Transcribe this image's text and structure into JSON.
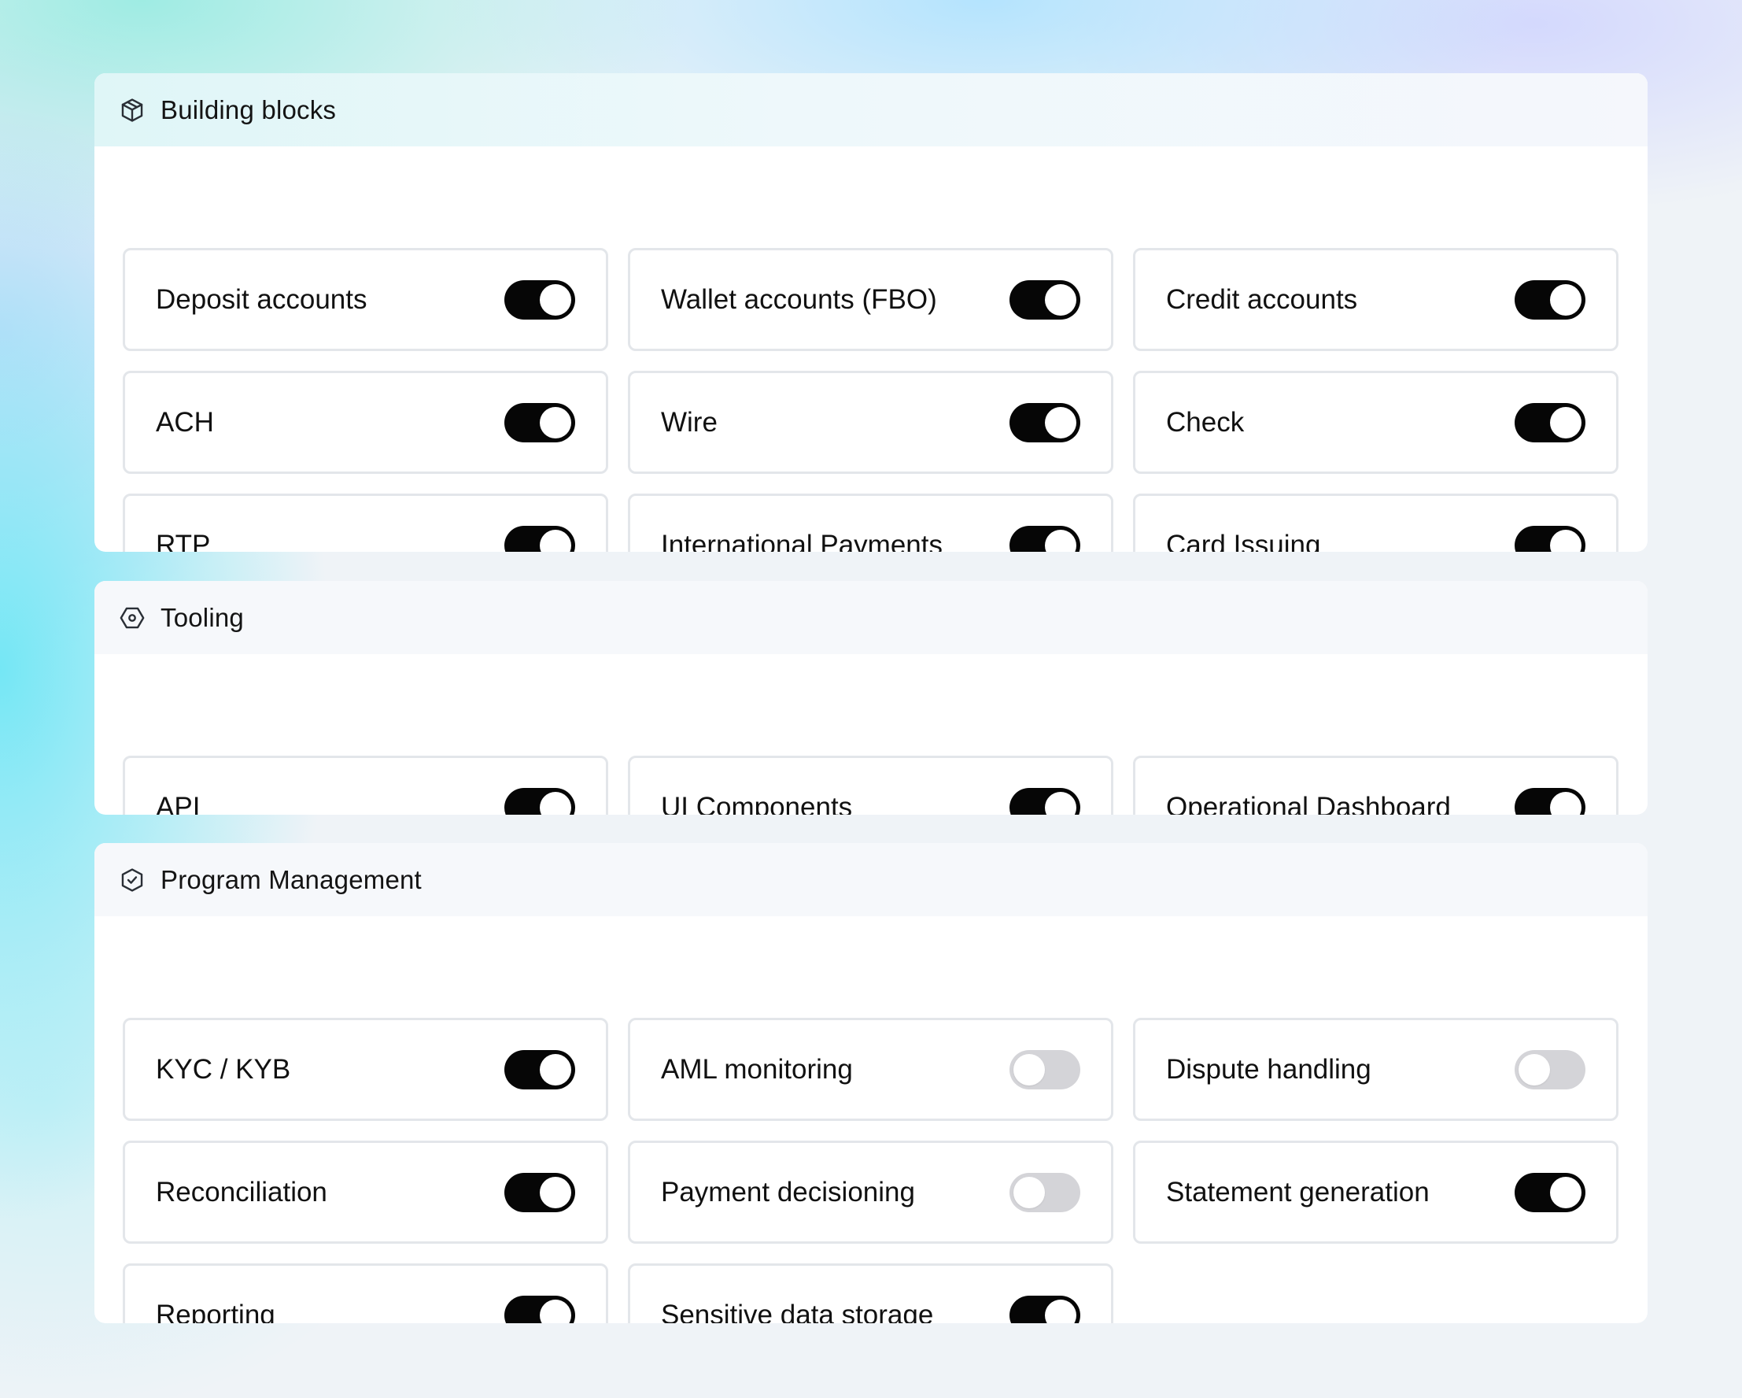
{
  "sections": [
    {
      "title": "Building blocks",
      "icon": "cube-icon",
      "items": [
        {
          "label": "Deposit accounts",
          "enabled": true
        },
        {
          "label": "Wallet accounts (FBO)",
          "enabled": true
        },
        {
          "label": "Credit accounts",
          "enabled": true
        },
        {
          "label": "ACH",
          "enabled": true
        },
        {
          "label": "Wire",
          "enabled": true
        },
        {
          "label": "Check",
          "enabled": true
        },
        {
          "label": "RTP",
          "enabled": true
        },
        {
          "label": "International Payments",
          "enabled": true
        },
        {
          "label": "Card Issuing",
          "enabled": true
        }
      ]
    },
    {
      "title": "Tooling",
      "icon": "hexagon-nut-icon",
      "items": [
        {
          "label": "API",
          "enabled": true
        },
        {
          "label": "UI Components",
          "enabled": true
        },
        {
          "label": "Operational Dashboard",
          "enabled": true
        }
      ]
    },
    {
      "title": "Program Management",
      "icon": "hexagon-check-icon",
      "items": [
        {
          "label": "KYC / KYB",
          "enabled": true
        },
        {
          "label": "AML monitoring",
          "enabled": false
        },
        {
          "label": "Dispute handling",
          "enabled": false
        },
        {
          "label": "Reconciliation",
          "enabled": true
        },
        {
          "label": "Payment decisioning",
          "enabled": false
        },
        {
          "label": "Statement generation",
          "enabled": true
        },
        {
          "label": "Reporting",
          "enabled": true
        },
        {
          "label": "Sensitive data storage",
          "enabled": true
        }
      ]
    }
  ],
  "colors": {
    "toggle_on": "#060606",
    "toggle_off": "#d4d4d8"
  }
}
